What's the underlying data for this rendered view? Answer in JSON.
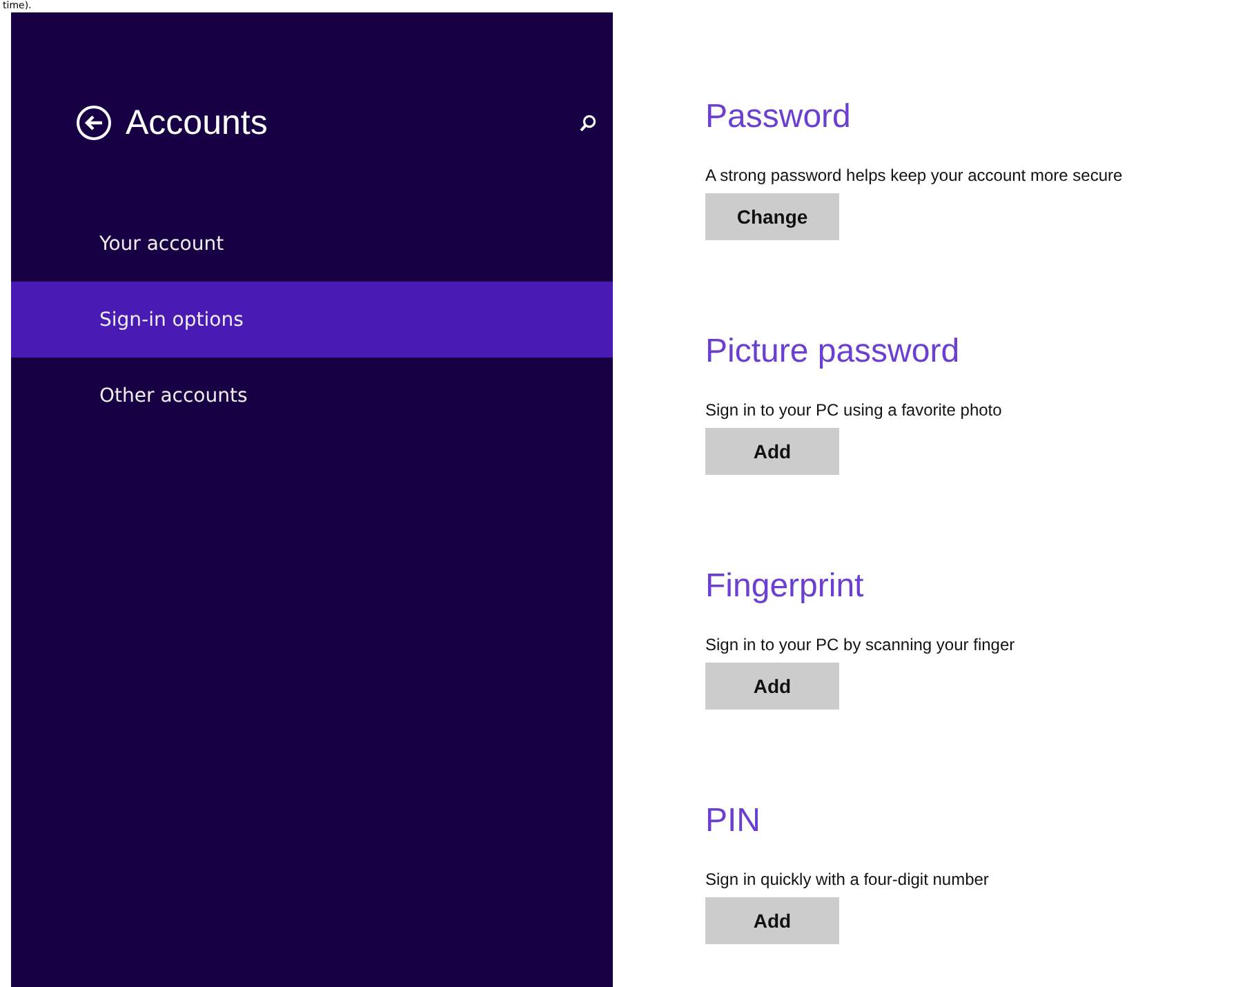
{
  "caption_fragment": "time).",
  "sidebar": {
    "title": "Accounts",
    "items": [
      {
        "label": "Your account",
        "selected": false
      },
      {
        "label": "Sign-in options",
        "selected": true
      },
      {
        "label": "Other accounts",
        "selected": false
      }
    ]
  },
  "sections": [
    {
      "heading": "Password",
      "description": "A strong password helps keep your account more secure",
      "button": "Change"
    },
    {
      "heading": "Picture password",
      "description": "Sign in to your PC using a favorite photo",
      "button": "Add"
    },
    {
      "heading": "Fingerprint",
      "description": "Sign in to your PC by scanning your finger",
      "button": "Add"
    },
    {
      "heading": "PIN",
      "description": "Sign in quickly with a four-digit number",
      "button": "Add"
    }
  ]
}
